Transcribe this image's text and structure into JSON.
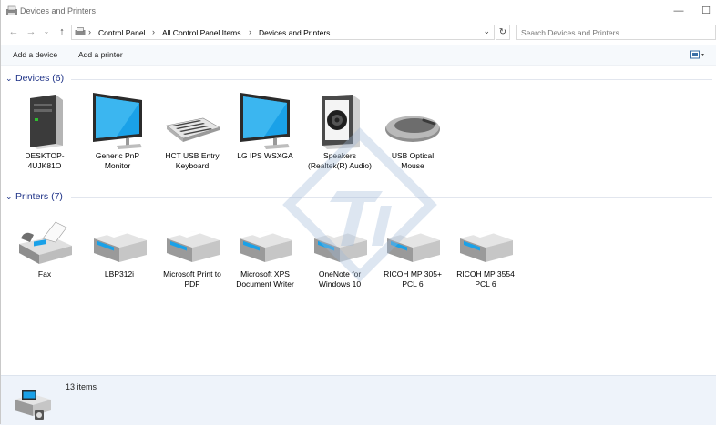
{
  "window": {
    "title": "Devices and Printers"
  },
  "window_controls": {
    "minimize": "—",
    "maximize": "☐"
  },
  "nav": {
    "back": "←",
    "forward": "→",
    "recent": "⌄",
    "up": "↑"
  },
  "address": {
    "breadcrumbs": [
      "Control Panel",
      "All Control Panel Items",
      "Devices and Printers"
    ],
    "separator": "›",
    "dropdown": "⌄",
    "refresh": "↻"
  },
  "search": {
    "placeholder": "Search Devices and Printers"
  },
  "commands": {
    "add_device": "Add a device",
    "add_printer": "Add a printer"
  },
  "groups": {
    "devices": {
      "title": "Devices (6)",
      "items": [
        {
          "label": "DESKTOP-4UJK81O",
          "icon": "computer-tower-icon"
        },
        {
          "label": "Generic PnP Monitor",
          "icon": "monitor-icon"
        },
        {
          "label": "HCT USB Entry Keyboard",
          "icon": "keyboard-icon"
        },
        {
          "label": "LG IPS WSXGA",
          "icon": "monitor-icon"
        },
        {
          "label": "Speakers (Realtek(R) Audio)",
          "icon": "speaker-icon"
        },
        {
          "label": "USB Optical Mouse",
          "icon": "mouse-icon"
        }
      ]
    },
    "printers": {
      "title": "Printers (7)",
      "items": [
        {
          "label": "Fax",
          "icon": "fax-icon"
        },
        {
          "label": "LBP312i",
          "icon": "printer-icon"
        },
        {
          "label": "Microsoft Print to PDF",
          "icon": "printer-icon"
        },
        {
          "label": "Microsoft XPS Document Writer",
          "icon": "printer-icon"
        },
        {
          "label": "OneNote for Windows 10",
          "icon": "printer-icon"
        },
        {
          "label": "RICOH MP 305+ PCL 6",
          "icon": "printer-icon"
        },
        {
          "label": "RICOH MP 3554 PCL 6",
          "icon": "printer-icon"
        }
      ]
    }
  },
  "status": {
    "count": "13 items"
  },
  "colors": {
    "group_heading": "#1e3287",
    "details_bg": "#eef3fa",
    "monitor_screen": "#1aa1e8"
  }
}
